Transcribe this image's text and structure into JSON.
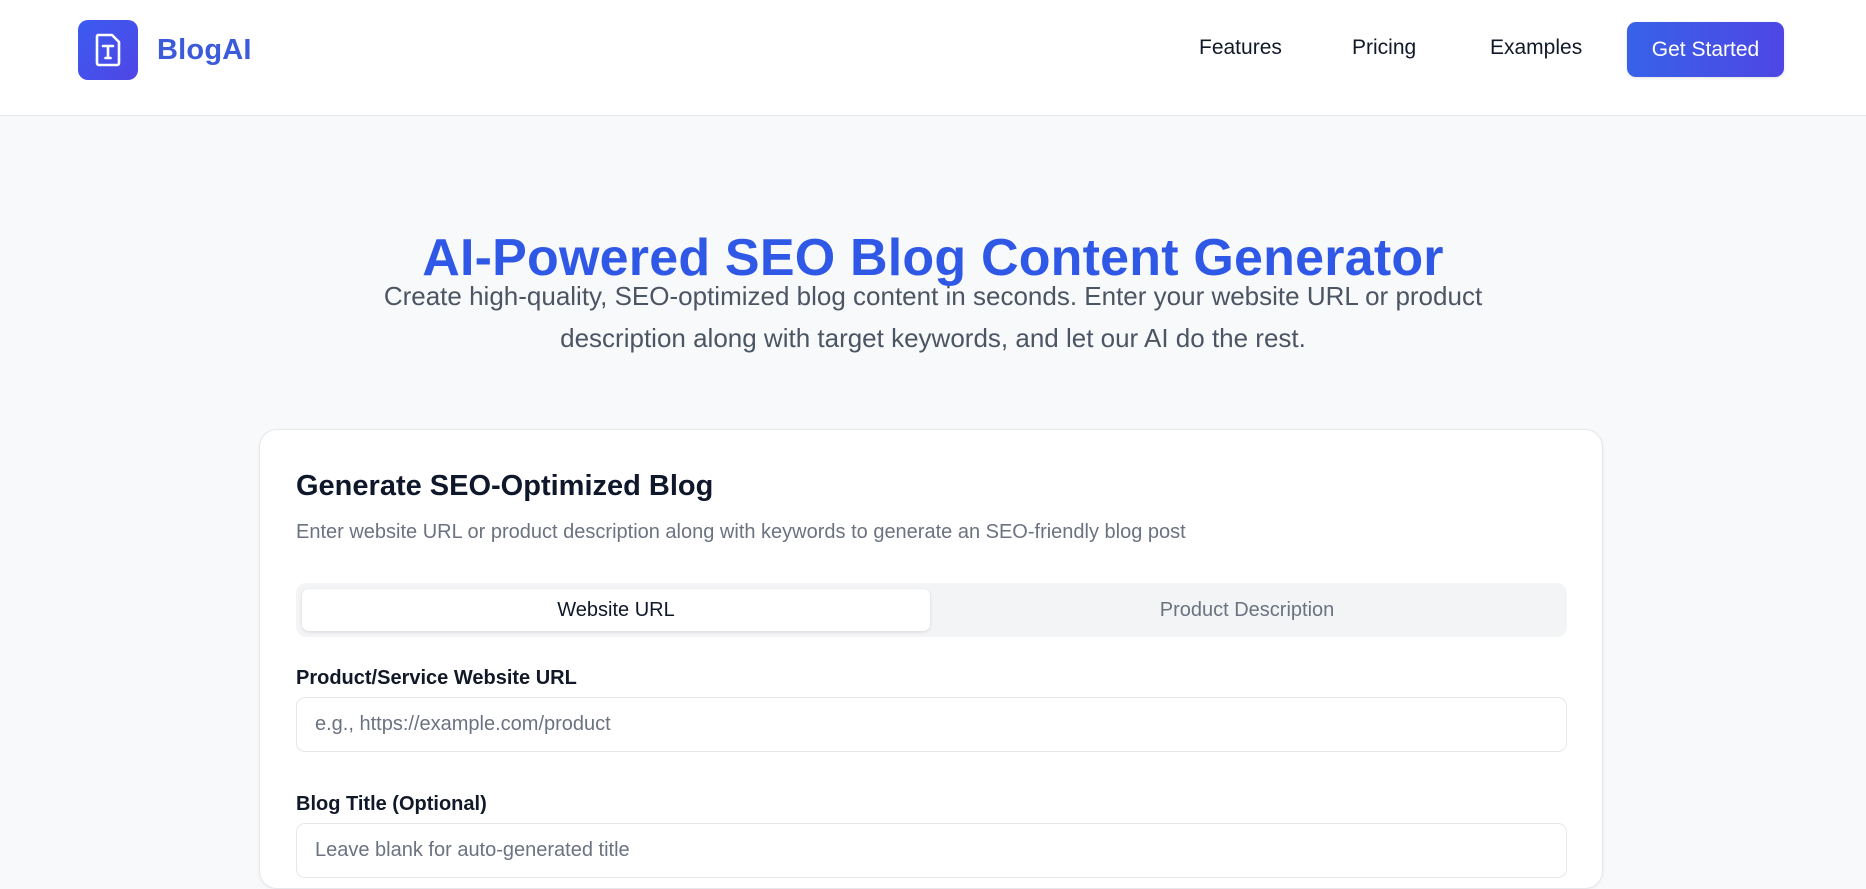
{
  "brand": {
    "name": "BlogAI",
    "logo_icon": "document-text-icon",
    "accent": "#3b5bdb"
  },
  "nav": {
    "links": [
      "Features",
      "Pricing",
      "Examples"
    ],
    "cta_label": "Get Started"
  },
  "hero": {
    "title": "AI-Powered SEO Blog Content Generator",
    "subtitle": "Create high-quality, SEO-optimized blog content in seconds. Enter your website URL or product description along with target keywords, and let our AI do the rest."
  },
  "form": {
    "title": "Generate SEO-Optimized Blog",
    "description": "Enter website URL or product description along with keywords to generate an SEO-friendly blog post",
    "tabs": [
      "Website URL",
      "Product Description"
    ],
    "active_tab": "Website URL",
    "url_label": "Product/Service Website URL",
    "url_placeholder": "e.g., https://example.com/product",
    "url_value": "",
    "title_label": "Blog Title (Optional)",
    "title_placeholder": "Leave blank for auto-generated title",
    "title_value": ""
  }
}
